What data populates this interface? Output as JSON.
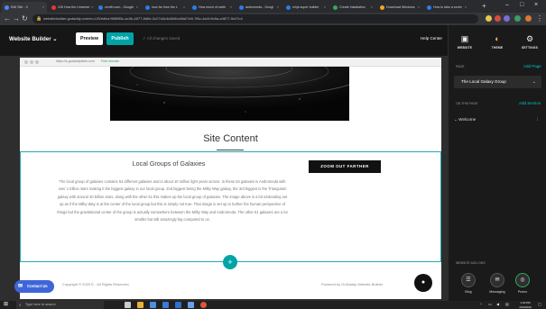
{
  "browser": {
    "tabs": [
      {
        "label": "Edit Site - X",
        "fav": "#4f86f7",
        "active": true
      },
      {
        "label": "226 How the Universe",
        "fav": "#e33"
      },
      {
        "label": "zenith.com - Google",
        "fav": "#2b7de9"
      },
      {
        "label": "how far from the L",
        "fav": "#2b7de9"
      },
      {
        "label": "How much of earth",
        "fav": "#2b7de9"
      },
      {
        "label": "andromeda - Googl",
        "fav": "#2b7de9"
      },
      {
        "label": "ninja super builder",
        "fav": "#2b7de9"
      },
      {
        "label": "Create installation",
        "fav": "#3aa757"
      },
      {
        "label": "Download Windows",
        "fav": "#f5a623"
      },
      {
        "label": "How to take a scree",
        "fav": "#2b7de9"
      }
    ],
    "new_tab": "+",
    "url": "websitebuilder.godaddy.com/en-US/editor/9f8f8f3c-ac3b-4877-8d6e-2c27a3c4d4b5/cd8a27a9-7f6c-4a4f-9e8a-a4877-5c07c4",
    "window_controls": [
      "–",
      "□",
      "×"
    ]
  },
  "editor": {
    "product_label": "Website Builder",
    "preview_label": "Preview",
    "publish_label": "Publish",
    "saved_status": "All changes saved",
    "help_label": "Help Center"
  },
  "right_panel": {
    "tabs": [
      {
        "label": "WEBSITE",
        "icon": "monitor-icon",
        "glyph": "▣"
      },
      {
        "label": "THEME",
        "icon": "palette-icon",
        "glyph": "◐"
      },
      {
        "label": "SETTINGS",
        "icon": "gear-icon",
        "glyph": "⚙"
      }
    ],
    "page_label": "PAGE",
    "add_page": "Add Page",
    "selected_page": "The Local Galaxy Group",
    "on_this_page": "ON THIS PAGE",
    "add_section": "Add Section",
    "section_item": "Welcome",
    "apps_label": "WEBSITE ADD-ONS",
    "apps": [
      {
        "label": "Blog",
        "glyph": "☰"
      },
      {
        "label": "Messaging",
        "glyph": "✉"
      },
      {
        "label": "Promo",
        "glyph": "◎"
      }
    ]
  },
  "site": {
    "url": "https://s-godaddysites.com",
    "badge": "Free domain",
    "title": "Site Content",
    "section_heading": "Local Groups of Galaxies",
    "zoom_button": "ZOOM OUT FARTHER",
    "body": "The local group of galaxies contains 54 different galaxies and is about 10 million light years across. In these 54 galaxies is Andromeda with over 1 trillion stars making it the biggest galaxy in our local group. 2nd biggest being the Milky Way galaxy, the 3rd biggest is the Triangulum galaxy with around 40 billion stars, along with the other 51 this makes up the local group of galaxies. The image above is a bit misleading set up as if the Milky Way is at the center of the local group but this is simply not true. That image is set up to further the human perspective of things but the gravitational center of the group is actually somewhere between the Milky Way and Andromeda. The other 51 galaxies are a lot smaller but still amazingly big compared to us.",
    "footer_copyright": "Copyright © 2020 E - All Rights Reserved.",
    "footer_powered": "Powered by GoDaddy Website Builder",
    "add_section_symbol": "+",
    "chat_glyph": "●"
  },
  "contact_button": "Contact Us",
  "taskbar": {
    "search_placeholder": "Type here to search",
    "time": "1:40 PM",
    "date": "2/19/2020"
  }
}
